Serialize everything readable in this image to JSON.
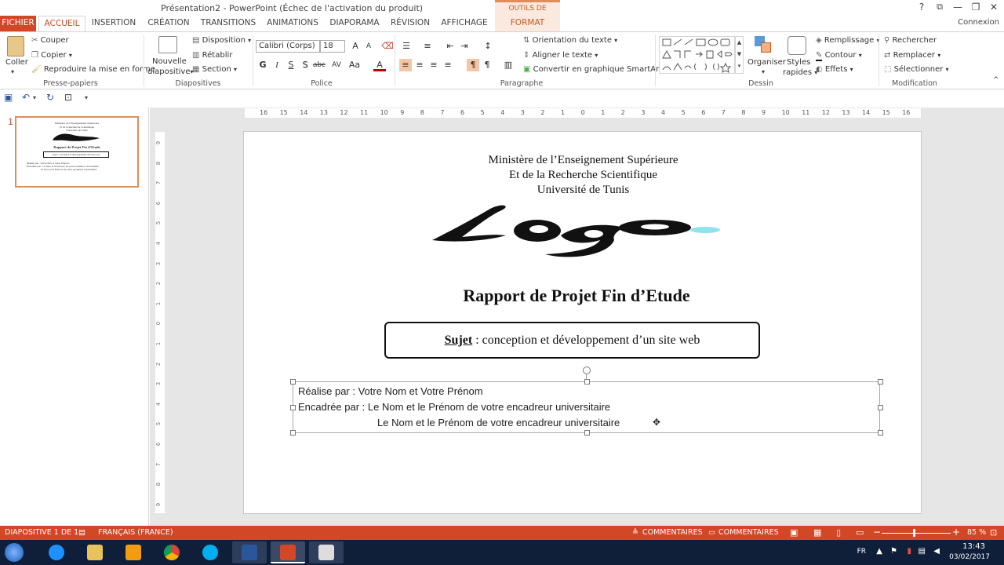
{
  "window": {
    "title": "Présentation2 - PowerPoint (Échec de l'activation du produit)",
    "contextual_group": "OUTILS DE DESSIN",
    "help": "?",
    "restore": "⧉",
    "minimize": "—",
    "maximize": "❐",
    "close": "✕",
    "account": "Connexion"
  },
  "tabs": [
    "FICHIER",
    "ACCUEIL",
    "INSERTION",
    "CRÉATION",
    "TRANSITIONS",
    "ANIMATIONS",
    "DIAPORAMA",
    "RÉVISION",
    "AFFICHAGE",
    "FORMAT"
  ],
  "ribbon": {
    "clipboard": {
      "label": "Presse-papiers",
      "paste": "Coller",
      "cut": "Couper",
      "copy": "Copier",
      "format_painter": "Reproduire la mise en forme"
    },
    "slides": {
      "label": "Diapositives",
      "new_slide": "Nouvelle",
      "new_slide2": "diapositive",
      "layout": "Disposition",
      "reset": "Rétablir",
      "section": "Section"
    },
    "font": {
      "label": "Police",
      "font_name": "Calibri (Corps)",
      "font_size": "18",
      "bold": "G",
      "italic": "I",
      "underline": "S",
      "shadow": "S",
      "strike": "abc",
      "spacing": "AV",
      "case": "Aa",
      "color": "A",
      "grow": "A",
      "shrink": "A"
    },
    "paragraph": {
      "label": "Paragraphe",
      "text_direction": "Orientation du texte",
      "align_text": "Aligner le texte",
      "smartart": "Convertir en graphique SmartArt"
    },
    "drawing": {
      "label": "Dessin",
      "arrange": "Organiser",
      "quick_styles": "Styles",
      "quick_styles2": "rapides",
      "fill": "Remplissage",
      "outline": "Contour",
      "effects": "Effets"
    },
    "editing": {
      "label": "Modification",
      "find": "Rechercher",
      "replace": "Remplacer",
      "select": "Sélectionner"
    }
  },
  "thumbnails": [
    {
      "number": "1"
    }
  ],
  "slide": {
    "ministry_line1": "Ministère de l’Enseignement Supérieure",
    "ministry_line2": "Et de la Recherche Scientifique",
    "ministry_line3": "Université de Tunis",
    "logo_text": "Logo",
    "report_title": "Rapport de Projet Fin d’Etude",
    "subject_label": "Sujet",
    "subject_text": " : conception et développement d’un site web",
    "line1": "Réalise par : Votre Nom et Votre Prénom",
    "line2": "Encadrée par : Le Nom et le Prénom de votre encadreur universitaire",
    "line3": "Le Nom et le Prénom de votre encadreur universitaire"
  },
  "ruler": {
    "h_ticks": [
      "16",
      "15",
      "14",
      "13",
      "12",
      "11",
      "10",
      "9",
      "8",
      "7",
      "6",
      "5",
      "4",
      "3",
      "2",
      "1",
      "0",
      "1",
      "2",
      "3",
      "4",
      "5",
      "6",
      "7",
      "8",
      "9",
      "10",
      "11",
      "12",
      "13",
      "14",
      "15",
      "16"
    ],
    "v_ticks": [
      "9",
      "8",
      "7",
      "6",
      "5",
      "4",
      "3",
      "2",
      "1",
      "0",
      "1",
      "2",
      "3",
      "4",
      "5",
      "6",
      "7",
      "8",
      "9"
    ]
  },
  "status": {
    "slide_info": "DIAPOSITIVE 1 DE 1",
    "language": "FRANÇAIS (FRANCE)",
    "notes": "COMMENTAIRES",
    "comments": "COMMENTAIRES",
    "zoom": "85 %",
    "zoom_minus": "−",
    "zoom_plus": "+"
  },
  "taskbar": {
    "lang": "FR",
    "time": "13:43",
    "date": "03/02/2017"
  },
  "colors": {
    "accent": "#d24726",
    "taskbar": "#0f1f3a"
  }
}
